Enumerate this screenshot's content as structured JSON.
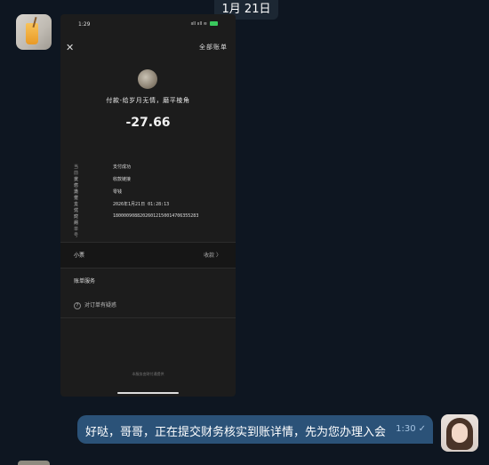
{
  "header": {
    "date_label": "1月 21日"
  },
  "screenshot": {
    "status_time": "1:29",
    "status_icons": "ııll ııll ≋",
    "top_right": "全部账单",
    "merchant_line": "付款-给岁月无情，磨平棱角",
    "amount": "-27.66",
    "details": [
      {
        "label": "当前状态",
        "value": "支付成功"
      },
      {
        "label": "支付场景",
        "value": "收款链接"
      },
      {
        "label": "支付方式",
        "value": "零钱"
      },
      {
        "label": "支付时间",
        "value": "2026年1月21日 01:28:13"
      },
      {
        "label": "交易单号",
        "value": "1800009088202601215001470635528З"
      }
    ],
    "note_label": "小票",
    "note_action": "收款 〉",
    "bill_service": "账单服务",
    "question": "对订单有疑惑",
    "footer": "本服务由财付通提供"
  },
  "message": {
    "text": "好哒，哥哥，正在提交财务核实到账详情，先为您办理入会",
    "time": "1:30",
    "status": "read"
  },
  "colors": {
    "bg": "#0e1621",
    "bubble": "#2b5278",
    "pill": "#1c2733"
  }
}
